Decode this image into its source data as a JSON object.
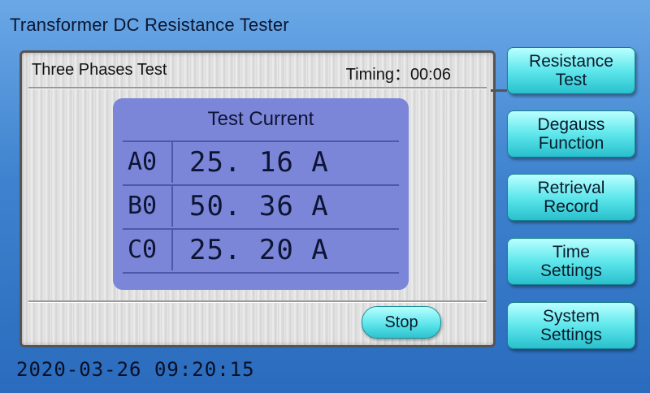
{
  "app": {
    "title": "Transformer DC Resistance Tester"
  },
  "panel": {
    "title": "Three Phases Test",
    "timing_label": "Timing：00:06"
  },
  "current": {
    "title": "Test Current",
    "rows": [
      {
        "phase": "A0",
        "value": "25. 16 A"
      },
      {
        "phase": "B0",
        "value": "50. 36 A"
      },
      {
        "phase": "C0",
        "value": "25. 20 A"
      }
    ]
  },
  "controls": {
    "stop_label": "Stop"
  },
  "sidebar": {
    "buttons": [
      {
        "line1": "Resistance",
        "line2": "Test"
      },
      {
        "line1": "Degauss",
        "line2": "Function"
      },
      {
        "line1": "Retrieval",
        "line2": "Record"
      },
      {
        "line1": "Time",
        "line2": "Settings"
      },
      {
        "line1": "System",
        "line2": "Settings"
      }
    ]
  },
  "status": {
    "datetime": "2020-03-26 09:20:15"
  },
  "colors": {
    "background": "#3f83cf",
    "current_box": "#7b86d8",
    "button": "#5fe6ec"
  }
}
